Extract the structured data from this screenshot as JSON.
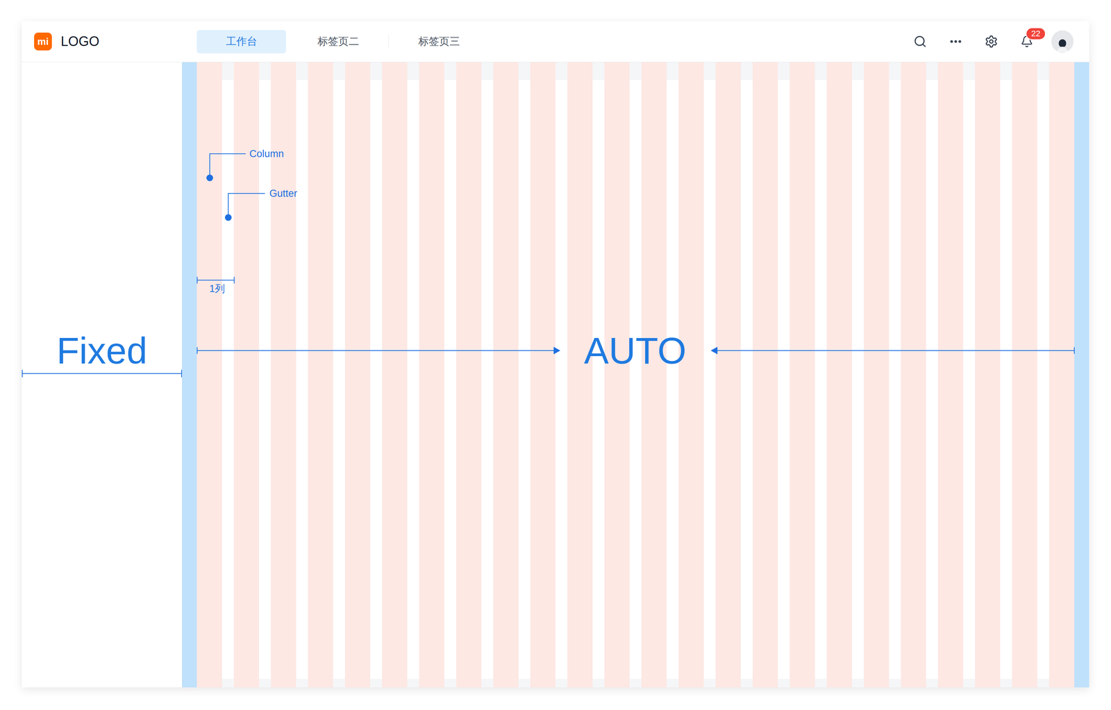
{
  "header": {
    "logo": {
      "mark": "mi",
      "text": "LOGO"
    },
    "tabs": [
      {
        "label": "工作台",
        "selected": true
      },
      {
        "label": "标签页二",
        "selected": false
      },
      {
        "label": "标签页三",
        "selected": false
      }
    ],
    "notifications": {
      "badge": "22"
    }
  },
  "grid": {
    "column_count": 24
  },
  "annotations": {
    "column": "Column",
    "gutter": "Gutter",
    "span": "1列",
    "fixed": "Fixed",
    "auto": "AUTO"
  }
}
